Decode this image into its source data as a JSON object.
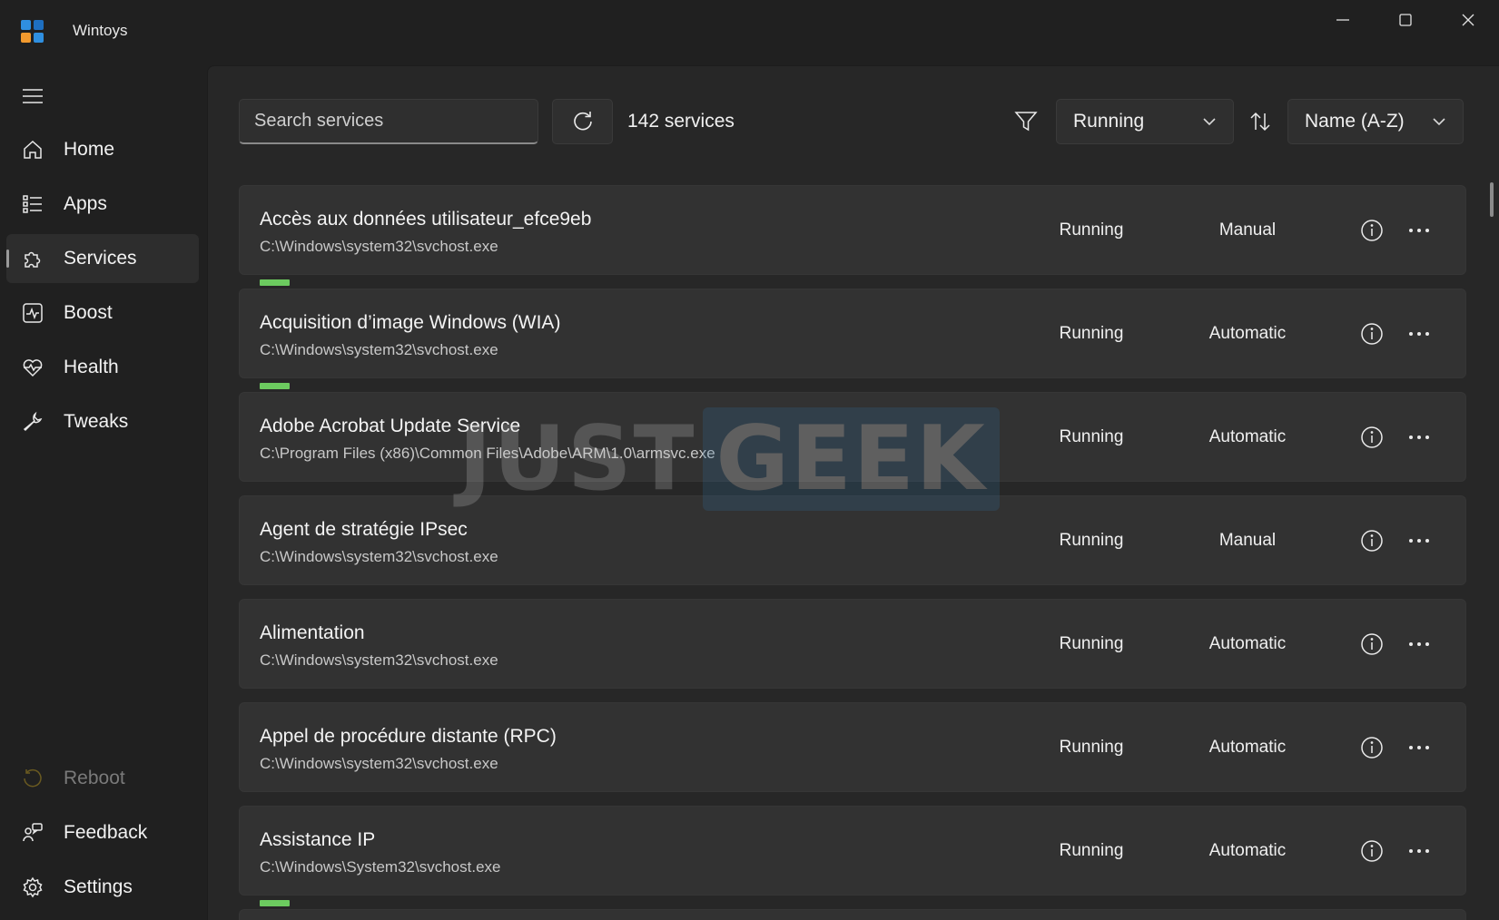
{
  "app": {
    "title": "Wintoys",
    "colors": {
      "logo_blue": "#2f8fe0",
      "logo_orange": "#f29a2e",
      "accent_green": "#6ccb5f"
    }
  },
  "window_controls": [
    "minimize-icon",
    "maximize-icon",
    "close-icon"
  ],
  "sidebar": {
    "menu_icon": "hamburger-icon",
    "items": [
      {
        "label": "Home",
        "icon": "home-icon"
      },
      {
        "label": "Apps",
        "icon": "apps-list-icon"
      },
      {
        "label": "Services",
        "icon": "puzzle-icon",
        "active": true
      },
      {
        "label": "Boost",
        "icon": "pulse-icon"
      },
      {
        "label": "Health",
        "icon": "heart-pulse-icon"
      },
      {
        "label": "Tweaks",
        "icon": "wrench-icon"
      }
    ],
    "bottom_items": [
      {
        "label": "Reboot",
        "icon": "reboot-icon",
        "disabled": true
      },
      {
        "label": "Feedback",
        "icon": "feedback-icon"
      },
      {
        "label": "Settings",
        "icon": "gear-icon"
      }
    ]
  },
  "toolbar": {
    "search_placeholder": "Search services",
    "count_label": "142 services",
    "status_filter": "Running",
    "sort_option": "Name (A-Z)"
  },
  "services": [
    {
      "name": "Accès aux données utilisateur_efce9eb",
      "path": "C:\\Windows\\system32\\svchost.exe",
      "status": "Running",
      "startup": "Manual",
      "bar": false
    },
    {
      "name": "Acquisition d’image Windows (WIA)",
      "path": "C:\\Windows\\system32\\svchost.exe",
      "status": "Running",
      "startup": "Automatic",
      "bar": true
    },
    {
      "name": "Adobe Acrobat Update Service",
      "path": "C:\\Program Files (x86)\\Common Files\\Adobe\\ARM\\1.0\\armsvc.exe",
      "status": "Running",
      "startup": "Automatic",
      "bar": true
    },
    {
      "name": "Agent de stratégie IPsec",
      "path": "C:\\Windows\\system32\\svchost.exe",
      "status": "Running",
      "startup": "Manual",
      "bar": false
    },
    {
      "name": "Alimentation",
      "path": "C:\\Windows\\system32\\svchost.exe",
      "status": "Running",
      "startup": "Automatic",
      "bar": false
    },
    {
      "name": "Appel de procédure distante (RPC)",
      "path": "C:\\Windows\\system32\\svchost.exe",
      "status": "Running",
      "startup": "Automatic",
      "bar": false
    },
    {
      "name": "Assistance IP",
      "path": "C:\\Windows\\System32\\svchost.exe",
      "status": "Running",
      "startup": "Automatic",
      "bar": false
    }
  ],
  "watermark": {
    "part1": "JUST",
    "part2": "GEEK"
  }
}
